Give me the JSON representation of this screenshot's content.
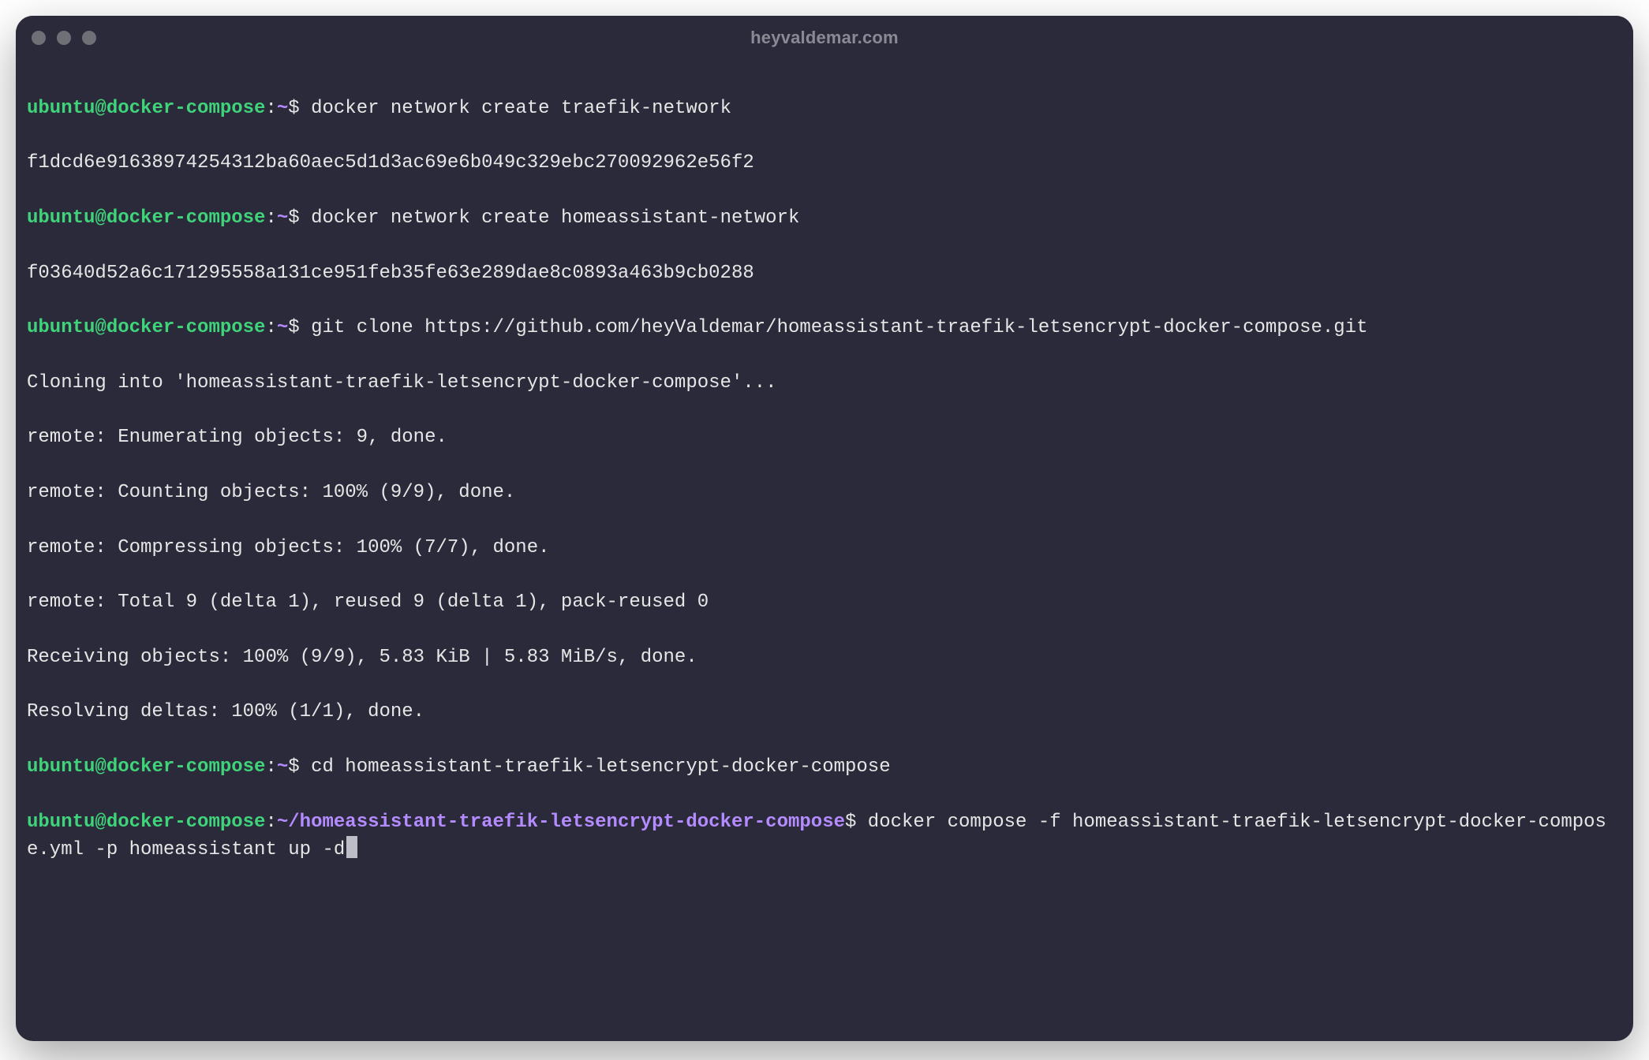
{
  "window": {
    "title": "heyvaldemar.com",
    "traffic": {
      "close": "close",
      "min": "minimize",
      "zoom": "zoom"
    }
  },
  "prompt": {
    "user": "ubuntu",
    "at": "@",
    "host": "docker-compose",
    "sep": ":",
    "home": "~",
    "cwd_long": "~/homeassistant-traefik-letsencrypt-docker-compose",
    "sym": "$"
  },
  "lines": {
    "cmd1": " docker network create traefik-network",
    "out1": "f1dcd6e91638974254312ba60aec5d1d3ac69e6b049c329ebc270092962e56f2",
    "cmd2": " docker network create homeassistant-network",
    "out2": "f03640d52a6c171295558a131ce951feb35fe63e289dae8c0893a463b9cb0288",
    "cmd3": " git clone https://github.com/heyValdemar/homeassistant-traefik-letsencrypt-docker-compose.git",
    "clone0": "Cloning into 'homeassistant-traefik-letsencrypt-docker-compose'...",
    "clone1": "remote: Enumerating objects: 9, done.",
    "clone2": "remote: Counting objects: 100% (9/9), done.",
    "clone3": "remote: Compressing objects: 100% (7/7), done.",
    "clone4": "remote: Total 9 (delta 1), reused 9 (delta 1), pack-reused 0",
    "clone5": "Receiving objects: 100% (9/9), 5.83 KiB | 5.83 MiB/s, done.",
    "clone6": "Resolving deltas: 100% (1/1), done.",
    "cmd4": " cd homeassistant-traefik-letsencrypt-docker-compose",
    "cmd5": " docker compose -f homeassistant-traefik-letsencrypt-docker-compose.yml -p homeassistant up -d"
  }
}
